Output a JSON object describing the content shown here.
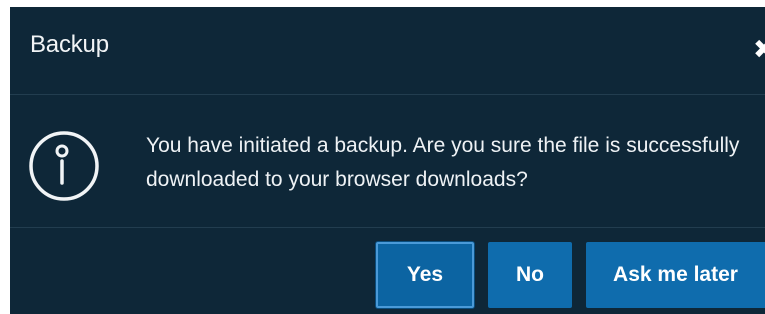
{
  "dialog": {
    "title": "Backup",
    "close_glyph": "✖",
    "icon": "info-circle-icon",
    "message": "You have initiated a backup. Are you sure the file is successfully downloaded to your browser downloads?",
    "buttons": {
      "yes": "Yes",
      "no": "No",
      "later": "Ask me later"
    },
    "colors": {
      "background": "#0e2738",
      "button": "#0f6cad",
      "text": "#f1f4f6"
    }
  }
}
